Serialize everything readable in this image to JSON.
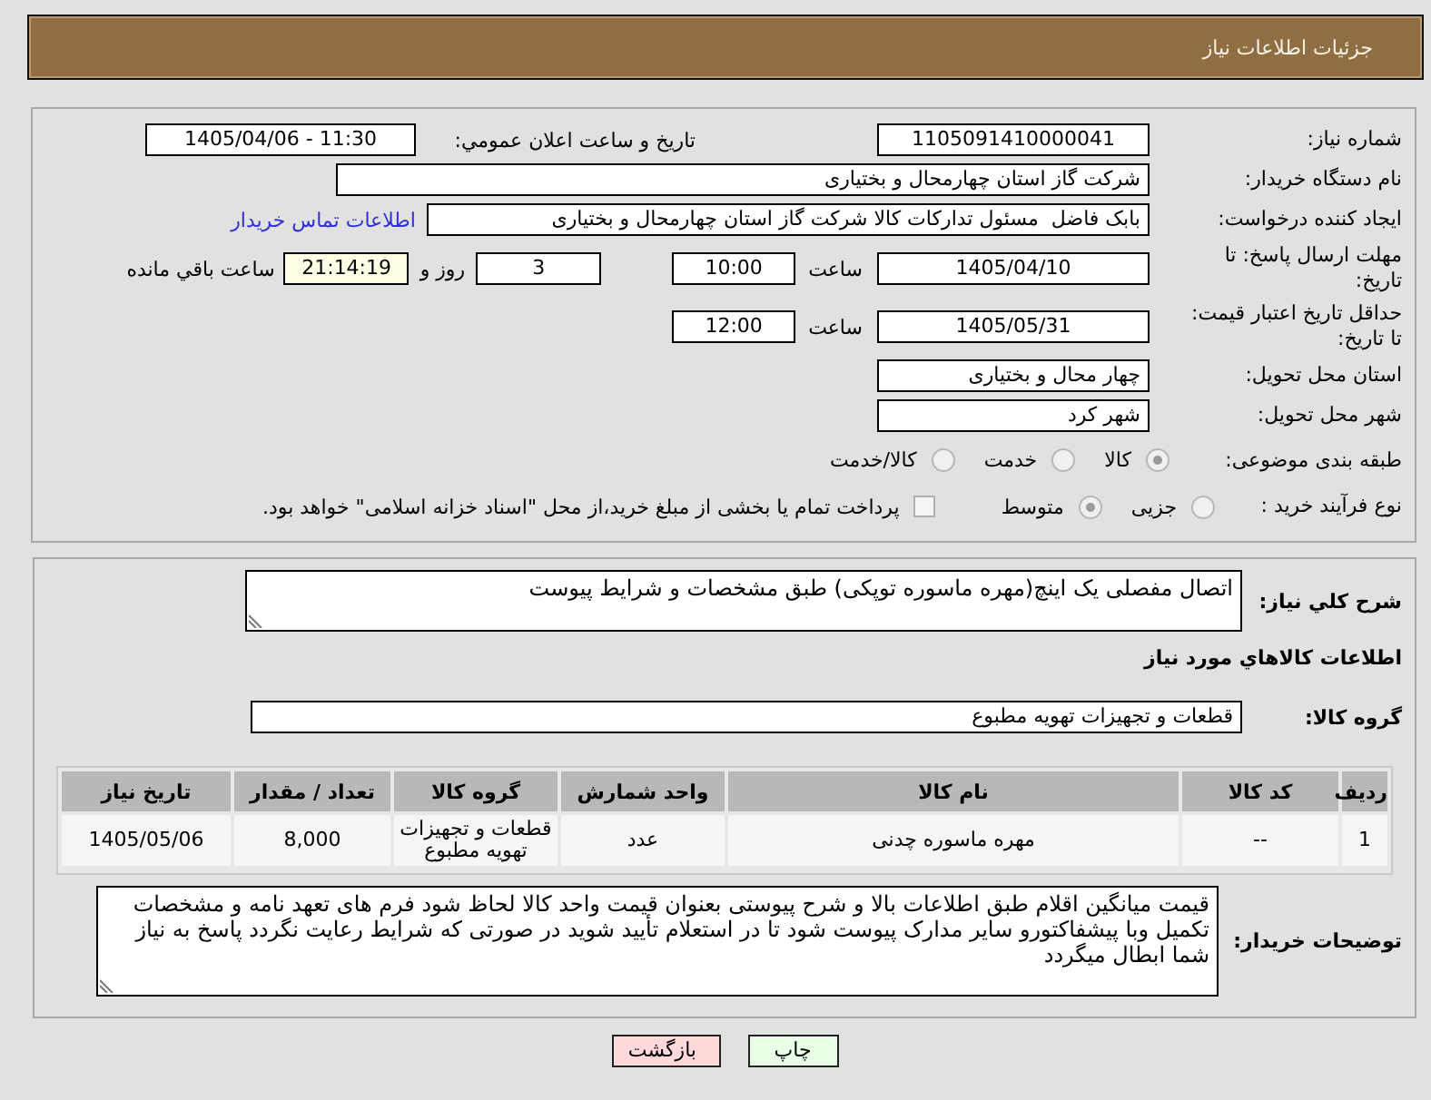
{
  "header": {
    "title": "جزئیات اطلاعات نیاز"
  },
  "summary": {
    "need_number": {
      "label": "شماره نیاز:",
      "value": "1105091410000041"
    },
    "announce": {
      "label": "تاریخ و ساعت اعلان عمومي:",
      "value": "1405/04/06 - 11:30"
    },
    "buyer": {
      "label": "نام دستگاه خریدار:",
      "value": "شرکت گاز استان چهارمحال و بختیاری"
    },
    "requester": {
      "label": "ایجاد کننده درخواست:",
      "value": "بابک فاضل  مسئول تدارکات کالا شرکت گاز استان چهارمحال و بختیاری",
      "contact_link": "اطلاعات تماس خریدار"
    },
    "deadline": {
      "label": "مهلت ارسال پاسخ: تا تاریخ:",
      "date": "1405/04/10",
      "time_label": "ساعت",
      "time": "10:00",
      "days": "3",
      "days_label": "روز و",
      "remaining": "21:14:19",
      "remaining_label": "ساعت باقي مانده"
    },
    "validity": {
      "label": "حداقل تاریخ اعتبار قیمت: تا تاریخ:",
      "date": "1405/05/31",
      "time_label": "ساعت",
      "time": "12:00"
    },
    "province": {
      "label": "استان محل تحویل:",
      "value": "چهار محال و بختیاری"
    },
    "city": {
      "label": "شهر محل تحویل:",
      "value": "شهر کرد"
    },
    "category": {
      "label": "طبقه بندی موضوعی:",
      "options": [
        {
          "label": "کالا",
          "selected": true
        },
        {
          "label": "خدمت",
          "selected": false
        },
        {
          "label": "کالا/خدمت",
          "selected": false
        }
      ]
    },
    "process": {
      "label": "نوع فرآیند خرید :",
      "options": [
        {
          "label": "جزیی",
          "selected": false
        },
        {
          "label": "متوسط",
          "selected": true
        }
      ],
      "treasury": {
        "label": "پرداخت تمام یا بخشی از مبلغ خرید،از محل \"اسناد خزانه اسلامی\" خواهد بود.",
        "checked": false
      }
    }
  },
  "need": {
    "description_label": "شرح کلي نیاز:",
    "description": "اتصال مفصلی یک اینچ(مهره ماسوره توپکی) طبق مشخصات و شرایط پیوست",
    "goods_heading": "اطلاعات کالاهاي مورد نیاز",
    "group_label": "گروه کالا:",
    "group": "قطعات و تجهیزات تهویه مطبوع",
    "table": {
      "columns": [
        "ردیف",
        "کد کالا",
        "نام کالا",
        "واحد شمارش",
        "گروه کالا",
        "تعداد / مقدار",
        "تاریخ نیاز"
      ],
      "rows": [
        [
          "1",
          "--",
          "مهره ماسوره چدنی",
          "عدد",
          "قطعات و تجهیزات تهویه مطبوع",
          "8,000",
          "1405/05/06"
        ]
      ]
    },
    "buyer_notes_label": "توضیحات خریدار:",
    "buyer_notes": "قیمت میانگین اقلام طبق اطلاعات بالا و شرح پیوستی بعنوان قیمت واحد  کالا  لحاظ شود فرم های تعهد نامه و مشخصات تکمیل وبا پیشفاکتورو سایر مدارک پیوست شود تا در استعلام تأیید شوید در صورتی که شرایط رعایت نگردد پاسخ به نیاز شما ابطال میگردد"
  },
  "buttons": [
    {
      "label": "چاپ",
      "kind": "print"
    },
    {
      "label": "بازگشت",
      "kind": "back"
    }
  ]
}
